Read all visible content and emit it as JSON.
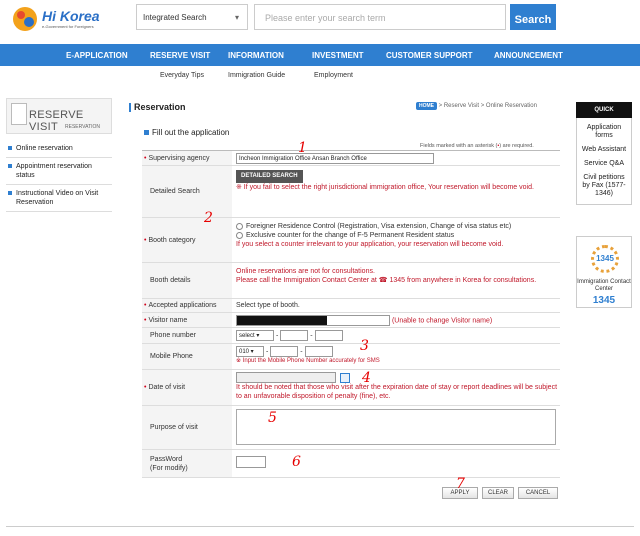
{
  "header": {
    "logo_brand": "Hi Korea",
    "logo_tag": "e-Government for Foreigners",
    "search_scope": "Integrated Search",
    "search_placeholder": "Please enter your search term",
    "search_button": "Search"
  },
  "nav": {
    "items": [
      "E-APPLICATION",
      "RESERVE VISIT",
      "INFORMATION",
      "INVESTMENT",
      "CUSTOMER SUPPORT",
      "ANNOUNCEMENT"
    ],
    "sub_items": [
      "Everyday Tips",
      "Immigration Guide",
      "Employment"
    ]
  },
  "sidebar": {
    "banner_title": "RESERVE VISIT",
    "banner_sub": "RESERVATION",
    "items": [
      "Online reservation",
      "Appointment reservation status",
      "Instructional Video on Visit Reservation"
    ]
  },
  "main": {
    "title": "Reservation",
    "breadcrumb_home": "HOME",
    "breadcrumb_rest": "> Reserve Visit > Online Reservation",
    "fill_title": "Fill out the application",
    "asterisk_note_a": "Fields marked with an asterisk (",
    "asterisk_note_star": "•",
    "asterisk_note_b": ") are required."
  },
  "form": {
    "supervising_agency_label": "Supervising agency",
    "supervising_agency_value": "Incheon Immigration Office Ansan Branch Office",
    "detailed_search_label": "Detailed Search",
    "detailed_search_button": "DETAILED SEARCH",
    "detailed_search_note": "※ If you fail to select the right jurisdictional immigration office, Your reservation will become void.",
    "booth_category_label": "Booth category",
    "booth_option_1": "Foreigner Residence Control (Registration, Visa extension, Change of visa status etc)",
    "booth_option_2": "Exclusive counter for the change of F-5 Permanent Resident status",
    "booth_note": "If you select a counter irrelevant to your application, your reservation will become void.",
    "booth_details_label": "Booth details",
    "booth_details_line1": "Online reservations are not for consultations.",
    "booth_details_line2": "Please call the Immigration Contact Center at ☎ 1345 from anywhere in Korea for consultations.",
    "accepted_label": "Accepted applications",
    "accepted_value": "Select type of booth.",
    "visitor_name_label": "Visitor name",
    "visitor_name_note": "(Unable to change Visitor name)",
    "phone_label": "Phone number",
    "phone_select": "select",
    "mobile_label": "Mobile Phone",
    "mobile_prefix": "010",
    "mobile_note": "※ Input the Mobile Phone Number accurately for SMS",
    "date_label": "Date of visit",
    "date_note": "It should be noted that those who visit after the expiration date of stay or report deadlines will be subject to an unfavorable disposition of penalty (fine), etc.",
    "purpose_label": "Purpose of visit",
    "password_label": "PassWord",
    "password_sub": "(For modify)",
    "dash": "-"
  },
  "actions": {
    "apply": "APPLY",
    "clear": "CLEAR",
    "cancel": "CANCEL"
  },
  "quick": {
    "title": "QUICK",
    "items": [
      "Application forms",
      "Web Assistant",
      "Service Q&A",
      "Civil petitions by Fax (1577-1346)"
    ],
    "contact_num": "1345",
    "contact_label": "Immigration Contact Center",
    "contact_big": "1345"
  },
  "annotations": [
    "1",
    "2",
    "3",
    "4",
    "5",
    "6",
    "7"
  ],
  "colors": {
    "accent": "#2f7fd0",
    "required": "#d0021b",
    "warning_text": "#c0182a"
  }
}
